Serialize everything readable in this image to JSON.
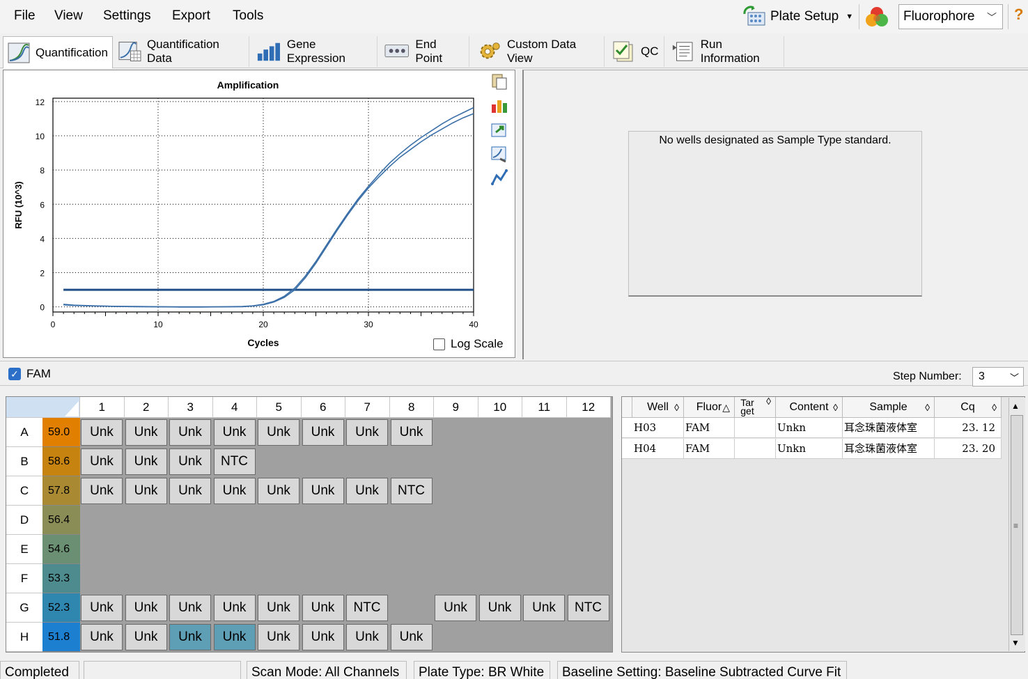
{
  "menu": {
    "file": "File",
    "view": "View",
    "settings": "Settings",
    "export": "Export",
    "tools": "Tools"
  },
  "toolbar": {
    "plate_setup": "Plate Setup",
    "fluorophore": "Fluorophore",
    "help": "?"
  },
  "tabs": [
    {
      "label": "Quantification",
      "active": true
    },
    {
      "label": "Quantification Data"
    },
    {
      "label": "Gene Expression"
    },
    {
      "label": "End Point"
    },
    {
      "label": "Custom Data View"
    },
    {
      "label": "QC"
    },
    {
      "label": "Run Information"
    }
  ],
  "standard_message": "No wells designated as Sample Type standard.",
  "log_scale_label": "Log Scale",
  "fluor_filter": {
    "label": "FAM",
    "checked": true
  },
  "step": {
    "label": "Step Number:",
    "value": "3"
  },
  "plate": {
    "columns": [
      "1",
      "2",
      "3",
      "4",
      "5",
      "6",
      "7",
      "8",
      "9",
      "10",
      "11",
      "12"
    ],
    "rows": [
      {
        "label": "A",
        "temp": "59.0",
        "color": "#e07f00",
        "wells": [
          "Unk",
          "Unk",
          "Unk",
          "Unk",
          "Unk",
          "Unk",
          "Unk",
          "Unk",
          "",
          "",
          "",
          ""
        ]
      },
      {
        "label": "B",
        "temp": "58.6",
        "color": "#c7830f",
        "wells": [
          "Unk",
          "Unk",
          "Unk",
          "NTC",
          "",
          "",
          "",
          "",
          "",
          "",
          "",
          ""
        ]
      },
      {
        "label": "C",
        "temp": "57.8",
        "color": "#a98a33",
        "wells": [
          "Unk",
          "Unk",
          "Unk",
          "Unk",
          "Unk",
          "Unk",
          "Unk",
          "NTC",
          "",
          "",
          "",
          ""
        ]
      },
      {
        "label": "D",
        "temp": "56.4",
        "color": "#8a8d55",
        "wells": [
          "",
          "",
          "",
          "",
          "",
          "",
          "",
          "",
          "",
          "",
          "",
          ""
        ]
      },
      {
        "label": "E",
        "temp": "54.6",
        "color": "#6a8f73",
        "wells": [
          "",
          "",
          "",
          "",
          "",
          "",
          "",
          "",
          "",
          "",
          "",
          ""
        ]
      },
      {
        "label": "F",
        "temp": "53.3",
        "color": "#4d8b8e",
        "wells": [
          "",
          "",
          "",
          "",
          "",
          "",
          "",
          "",
          "",
          "",
          "",
          ""
        ]
      },
      {
        "label": "G",
        "temp": "52.3",
        "color": "#2f86ae",
        "wells": [
          "Unk",
          "Unk",
          "Unk",
          "Unk",
          "Unk",
          "Unk",
          "NTC",
          "",
          "Unk",
          "Unk",
          "Unk",
          "NTC"
        ]
      },
      {
        "label": "H",
        "temp": "51.8",
        "color": "#1d7fd0",
        "wells": [
          "Unk",
          "Unk",
          "Unk",
          "Unk",
          "Unk",
          "Unk",
          "Unk",
          "Unk",
          "",
          "",
          "",
          ""
        ],
        "selected": [
          2,
          3
        ]
      }
    ]
  },
  "results": {
    "headers": [
      "Well",
      "Fluor",
      "Tar get",
      "Content",
      "Sample",
      "Cq"
    ],
    "rows": [
      [
        "H03",
        "FAM",
        "",
        "Unkn",
        "耳念珠菌液体室",
        "23. 12"
      ],
      [
        "H04",
        "FAM",
        "",
        "Unkn",
        "耳念珠菌液体室",
        "23. 20"
      ]
    ]
  },
  "status": {
    "state": "Completed",
    "blank": "",
    "scan_mode": "Scan Mode: All Channels",
    "plate_type": "Plate Type: BR White",
    "baseline": "Baseline Setting: Baseline Subtracted Curve Fit"
  },
  "chart_data": {
    "type": "line",
    "title": "Amplification",
    "xlabel": "Cycles",
    "ylabel": "RFU (10^3)",
    "xlim": [
      0,
      40
    ],
    "ylim": [
      -0.3,
      12.2
    ],
    "xticks": [
      0,
      10,
      20,
      30,
      40
    ],
    "yticks": [
      0,
      2,
      4,
      6,
      8,
      10,
      12
    ],
    "grid": true,
    "threshold": 1.0,
    "series": [
      {
        "well": "H03",
        "x": [
          1,
          2,
          4,
          6,
          8,
          10,
          12,
          14,
          16,
          18,
          19,
          20,
          21,
          22,
          23,
          24,
          25,
          26,
          27,
          28,
          29,
          30,
          31,
          32,
          33,
          34,
          35,
          36,
          37,
          38,
          39,
          40
        ],
        "y": [
          0.15,
          0.1,
          0.06,
          0.03,
          0.02,
          0.01,
          0.0,
          0.0,
          0.0,
          0.02,
          0.06,
          0.15,
          0.32,
          0.62,
          1.1,
          1.8,
          2.65,
          3.6,
          4.55,
          5.45,
          6.3,
          7.05,
          7.75,
          8.4,
          8.95,
          9.45,
          9.9,
          10.3,
          10.7,
          11.05,
          11.35,
          11.65
        ]
      },
      {
        "well": "H04",
        "x": [
          1,
          2,
          4,
          6,
          8,
          10,
          12,
          14,
          16,
          18,
          19,
          20,
          21,
          22,
          23,
          24,
          25,
          26,
          27,
          28,
          29,
          30,
          31,
          32,
          33,
          34,
          35,
          36,
          37,
          38,
          39,
          40
        ],
        "y": [
          0.12,
          0.08,
          0.05,
          0.03,
          0.01,
          0.0,
          -0.01,
          -0.01,
          0.0,
          0.01,
          0.05,
          0.12,
          0.28,
          0.55,
          1.0,
          1.7,
          2.55,
          3.5,
          4.45,
          5.35,
          6.2,
          6.95,
          7.6,
          8.2,
          8.75,
          9.2,
          9.65,
          10.05,
          10.4,
          10.75,
          11.05,
          11.3
        ]
      }
    ]
  },
  "colors": {
    "curve": "#3a6fa8",
    "threshold": "#1f4f86",
    "selected_well": "#5f9fb6"
  }
}
